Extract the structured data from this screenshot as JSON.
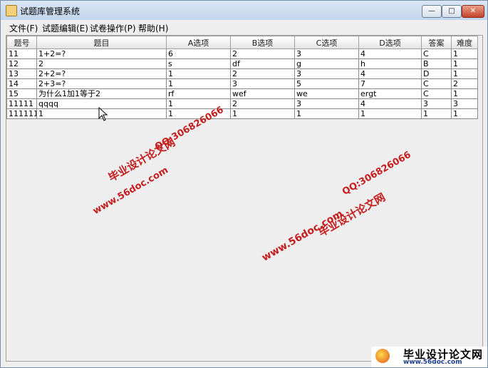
{
  "window": {
    "title": "试题库管理系统",
    "min_label": "—",
    "max_label": "□",
    "close_label": "✕"
  },
  "menu": {
    "file": "文件(F)",
    "edit": "试题编辑(E)",
    "paper": "试卷操作(P)",
    "help": "帮助(H)"
  },
  "table": {
    "columns": [
      "题号",
      "题目",
      "A选项",
      "B选项",
      "C选项",
      "D选项",
      "答案",
      "难度"
    ],
    "rows": [
      [
        "11",
        "1+2=?",
        "6",
        "2",
        "3",
        "4",
        "C",
        "1"
      ],
      [
        "12",
        "2",
        "s",
        "df",
        "g",
        "h",
        "B",
        "1"
      ],
      [
        "13",
        "2+2=?",
        "1",
        "2",
        "3",
        "4",
        "D",
        "1"
      ],
      [
        "14",
        "2+3=?",
        "1",
        "3",
        "5",
        "7",
        "C",
        "2"
      ],
      [
        "15",
        "为什么1加1等于2",
        "rf",
        "wef",
        "we",
        "ergt",
        "C",
        "1"
      ],
      [
        "11111",
        "qqqq",
        "1",
        "2",
        "3",
        "4",
        "3",
        "3"
      ],
      [
        "111111",
        "1",
        "1",
        "1",
        "1",
        "1",
        "1",
        "1"
      ]
    ]
  },
  "watermarks": {
    "w1": "毕业设计论文网",
    "w2": "QQ:306826066",
    "w3": "www.56doc.com",
    "w4": "www.56doc.com",
    "w5": "QQ:306826066",
    "w6": "毕业设计论文网"
  },
  "logo": {
    "name": "毕业设计论文网",
    "url": "www.56doc.com"
  },
  "colors": {
    "watermark": "#c41e1e",
    "titlebar": "#c3d6ec",
    "close_button": "#c5422a"
  }
}
